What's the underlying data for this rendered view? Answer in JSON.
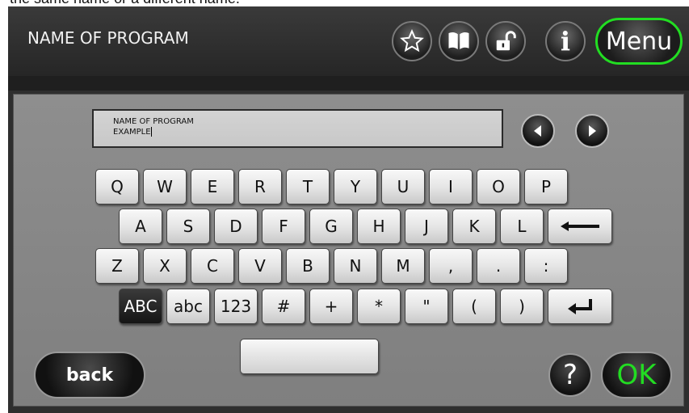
{
  "caption": "the same name or a different name.",
  "header": {
    "title": "NAME OF PROGRAM",
    "icons": [
      "star-icon",
      "book-icon",
      "unlock-icon",
      "info-icon"
    ],
    "info_glyph": "i",
    "menu_label": "Menu"
  },
  "textbox": {
    "line1": "NAME OF PROGRAM",
    "line2": "EXAMPLE"
  },
  "keyboard": {
    "row1": [
      "Q",
      "W",
      "E",
      "R",
      "T",
      "Y",
      "U",
      "I",
      "O",
      "P"
    ],
    "row2": [
      "A",
      "S",
      "D",
      "F",
      "G",
      "H",
      "J",
      "K",
      "L"
    ],
    "row3": [
      "Z",
      "X",
      "C",
      "V",
      "B",
      "N",
      "M",
      ",",
      ".",
      ":"
    ],
    "row4": [
      "ABC",
      "abc",
      "123",
      "#",
      "+",
      "*",
      "\"",
      "(",
      ")"
    ],
    "active_mode": "ABC"
  },
  "buttons": {
    "back": "back",
    "help": "?",
    "ok": "OK"
  },
  "colors": {
    "accent_green": "#22dd22",
    "panel_gray": "#8a8a8a",
    "header_dark": "#2e2e2e"
  }
}
